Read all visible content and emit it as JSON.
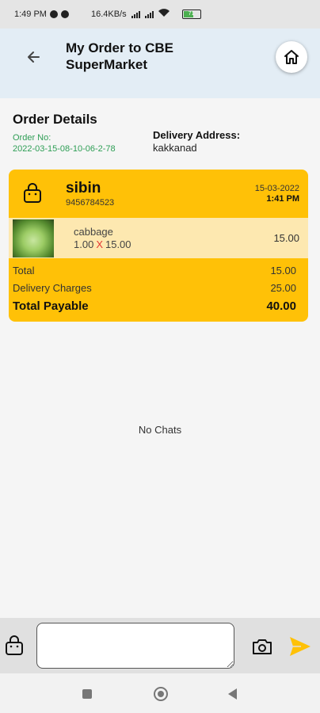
{
  "status_bar": {
    "time": "1:49 PM",
    "network_speed": "16.4KB/s",
    "volte_1": "Vo\nWiFi",
    "battery": "71"
  },
  "app_bar": {
    "title": "My Order to CBE SuperMarket",
    "back_icon": "arrow-back-icon",
    "home_icon": "home-icon"
  },
  "order": {
    "section_title": "Order Details",
    "order_no_label": "Order No:",
    "order_no": "2022-03-15-08-10-06-2-78",
    "address_label": "Delivery Address:",
    "address": "kakkanad",
    "customer_name": "sibin",
    "customer_phone": "9456784523",
    "date": "15-03-2022",
    "time": "1:41 PM",
    "items": [
      {
        "name": "cabbage",
        "qty": "1.00",
        "times": "X",
        "unit_price": "15.00",
        "amount": "15.00"
      }
    ],
    "summary": {
      "total_label": "Total",
      "total": "15.00",
      "delivery_label": "Delivery Charges",
      "delivery": "25.00",
      "payable_label": "Total Payable",
      "payable": "40.00"
    }
  },
  "chat": {
    "empty_text": "No Chats",
    "input_placeholder": ""
  },
  "colors": {
    "accent": "#ffc107",
    "item_bg": "#fde8b0",
    "appbar_bg": "#e3edf5",
    "order_no_green": "#2e9e55",
    "qty_x_red": "#e53935"
  }
}
